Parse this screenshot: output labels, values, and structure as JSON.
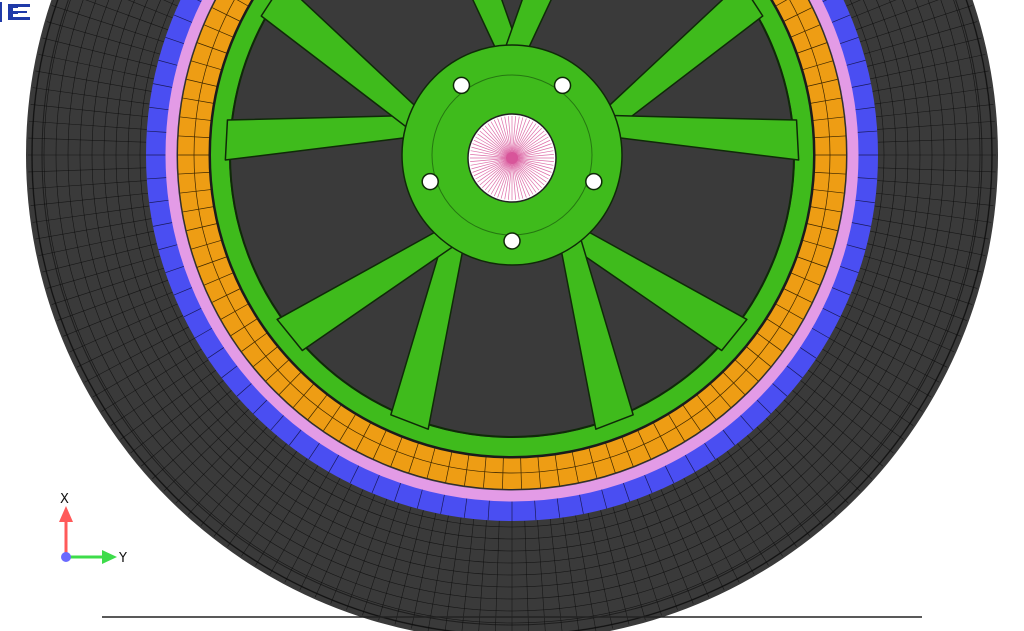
{
  "viewport": {
    "colors": {
      "background": "#ffffff",
      "tire": "#3a3a3a",
      "tire_edge": "#1e1e1e",
      "mesh_line": "#0c0c0c",
      "band_blue": "#4a4ef2",
      "band_pink": "#e39be6",
      "band_orange": "#ee9d14",
      "rim_green": "#3fbb1c",
      "hub_pink": "#d8559a",
      "ground_line": "#222222"
    }
  },
  "triad": {
    "x_label": "X",
    "y_label": "Y",
    "x_color": "#ff5a5a",
    "y_color": "#3ddc4a",
    "origin_color": "#6a6aff"
  },
  "logo": {
    "icon": "app-logo-icon",
    "color": "#1f3aa8"
  }
}
